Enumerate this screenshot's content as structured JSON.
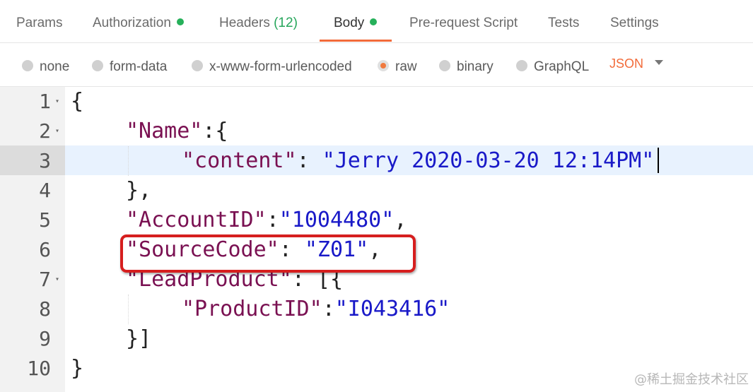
{
  "tabs": [
    {
      "label": "Params"
    },
    {
      "label": "Authorization",
      "has_dot": true
    },
    {
      "label": "Headers",
      "count": "(12)"
    },
    {
      "label": "Body",
      "has_dot": true,
      "active": true
    },
    {
      "label": "Pre-request Script"
    },
    {
      "label": "Tests"
    },
    {
      "label": "Settings"
    }
  ],
  "body_types": [
    "none",
    "form-data",
    "x-www-form-urlencoded",
    "raw",
    "binary",
    "GraphQL"
  ],
  "selected_body_type": "raw",
  "format_select": {
    "value": "JSON"
  },
  "editor": {
    "line_numbers": [
      "1",
      "2",
      "3",
      "4",
      "5",
      "6",
      "7",
      "8",
      "9",
      "10"
    ],
    "active_line": "3",
    "lines": {
      "l1": "{",
      "l2_key": "\"Name\"",
      "l2_rest": ":{",
      "l3_key": "\"content\"",
      "l3_sep": ": ",
      "l3_val": "\"Jerry 2020-03-20 12:14PM\"",
      "l4": "},",
      "l5_key": "\"AccountID\"",
      "l5_sep": ":",
      "l5_val": "\"1004480\"",
      "l5_end": ",",
      "l6_key": "\"SourceCode\"",
      "l6_sep": ": ",
      "l6_val": "\"Z01\"",
      "l6_end": ",",
      "l7_key": "\"LeadProduct\"",
      "l7_rest": ": [{",
      "l8_key": "\"ProductID\"",
      "l8_sep": ":",
      "l8_val": "\"I043416\"",
      "l9": "}]",
      "l10": "}"
    }
  },
  "watermark": "@稀土掘金技术社区",
  "colors": {
    "accent": "#f26b3a",
    "status_dot": "#26b05a",
    "key": "#7a1152",
    "string": "#1919c8",
    "annotation": "#d61e1e"
  }
}
